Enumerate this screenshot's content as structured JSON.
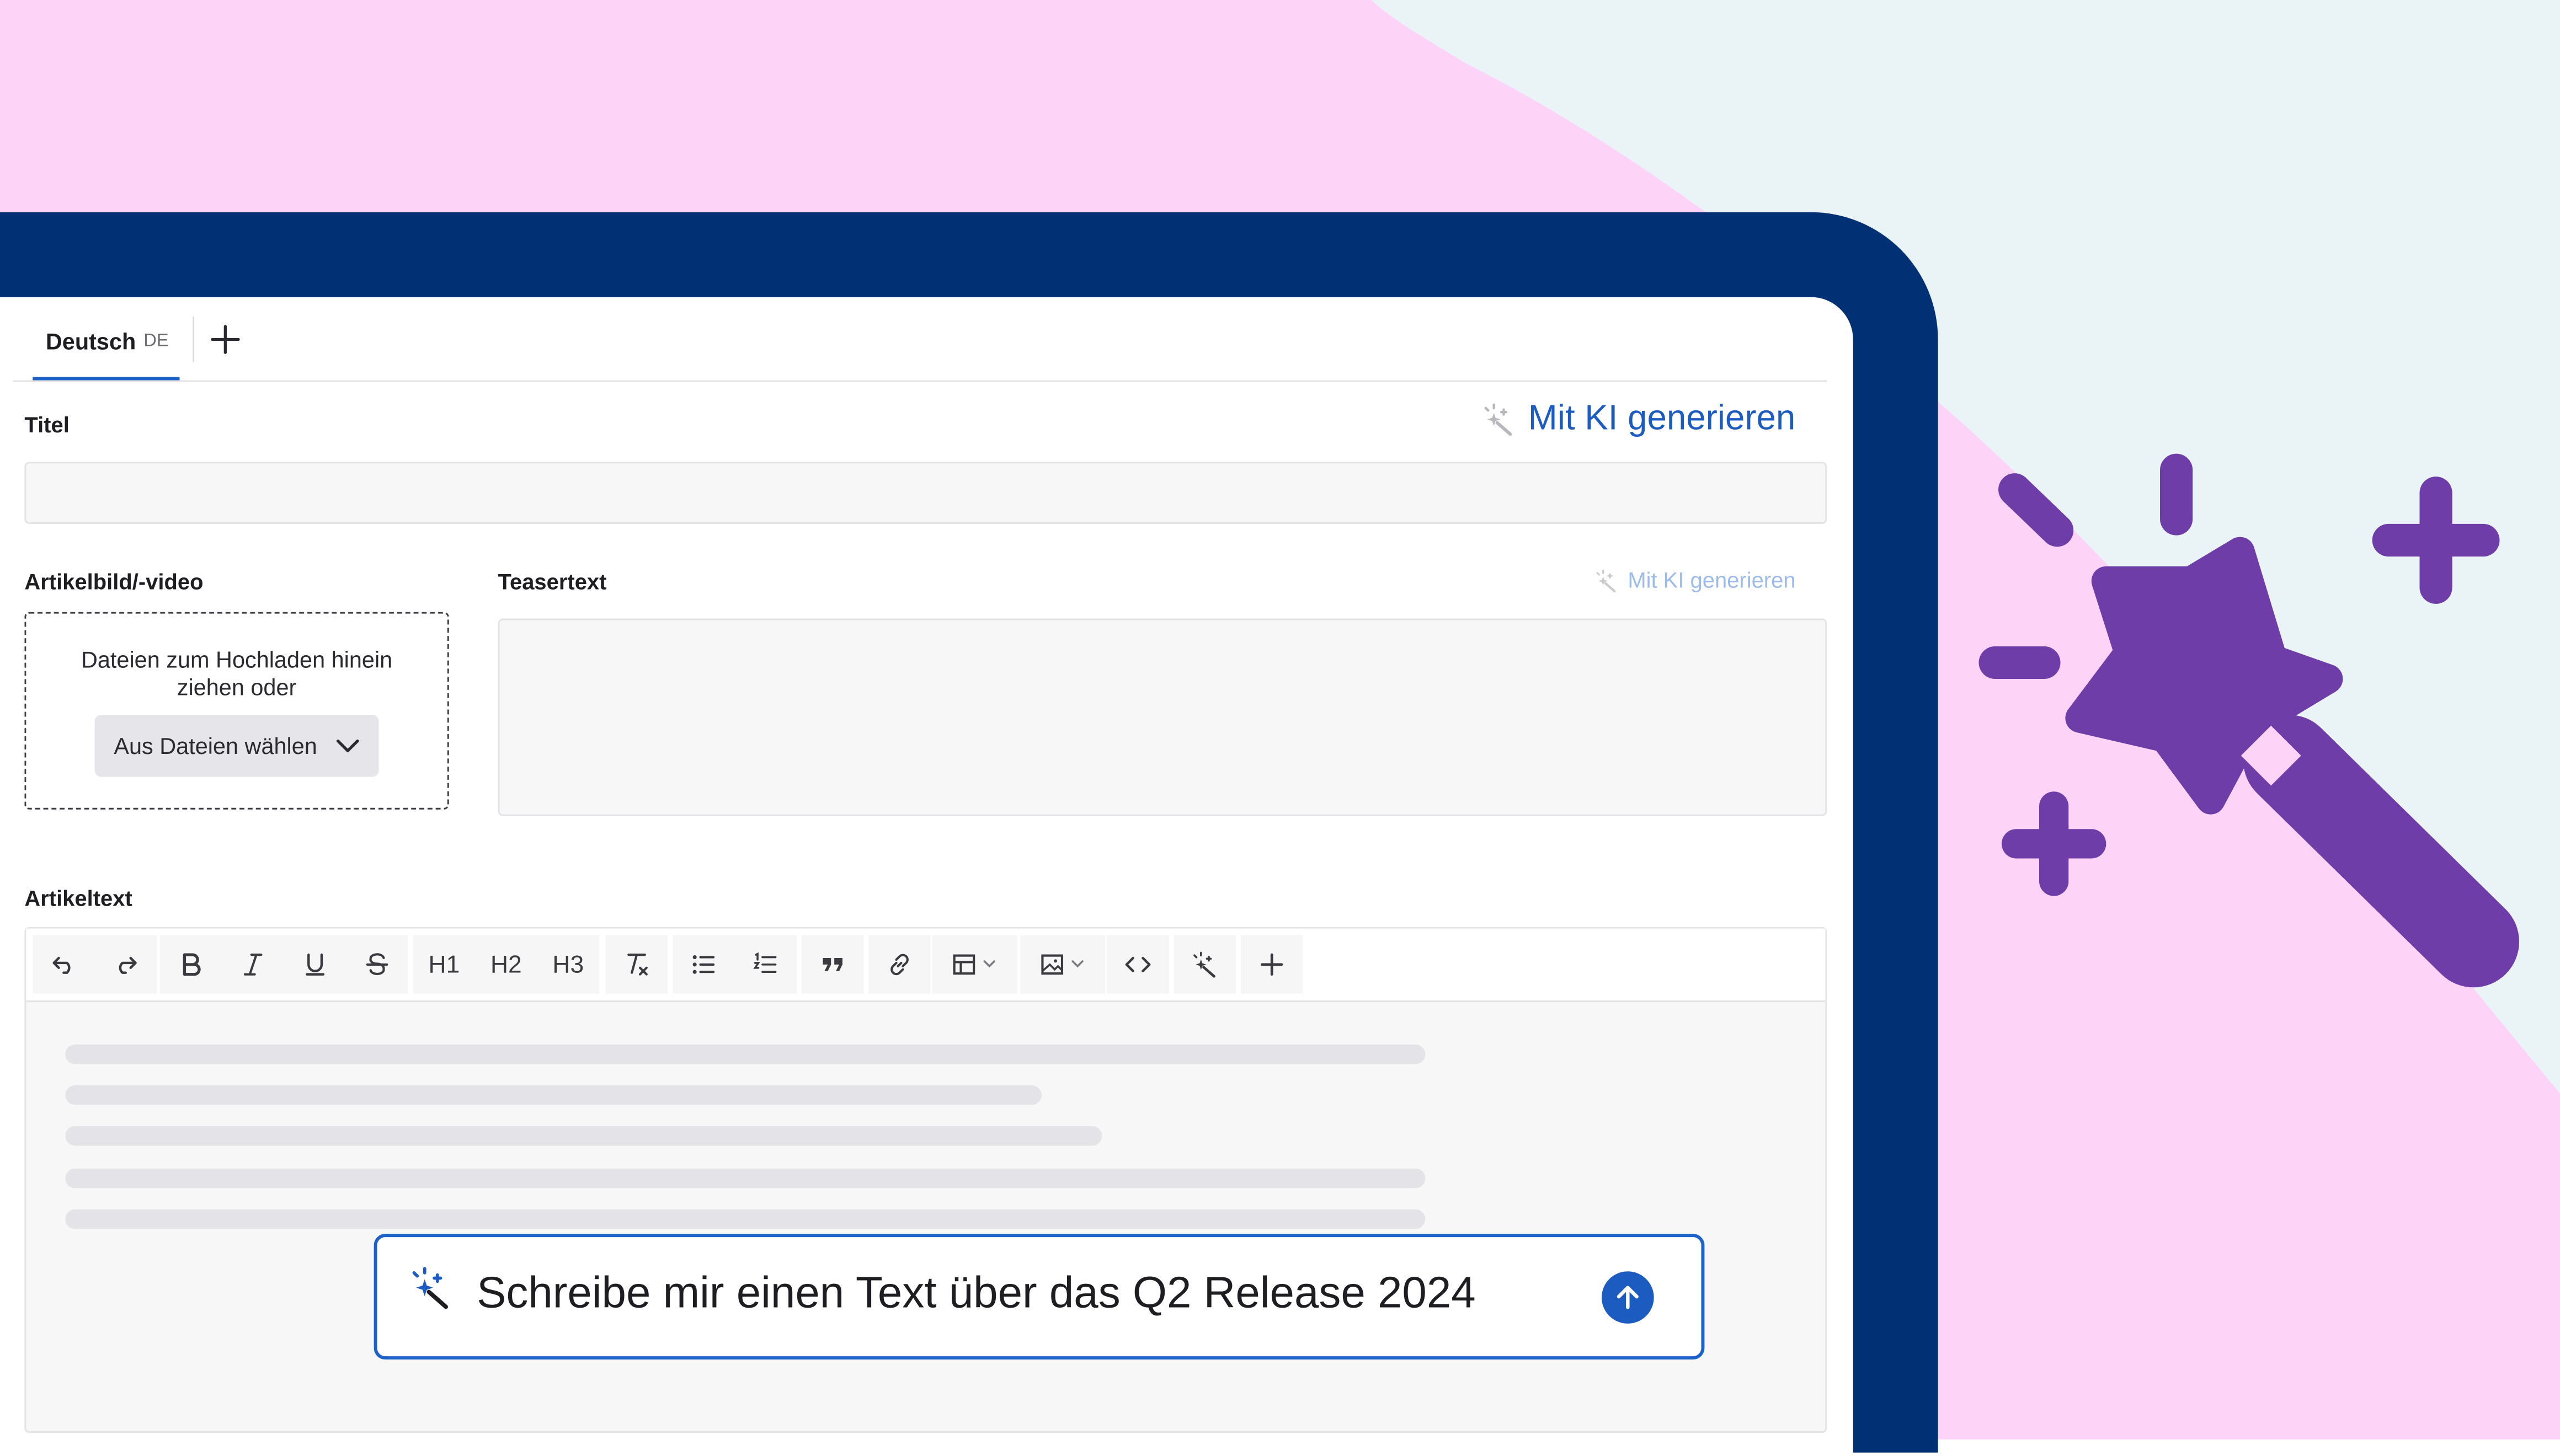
{
  "colors": {
    "pink": "#fdd3f8",
    "mint": "#eaf4f6",
    "navy": "#023074",
    "purple": "#6e3da8",
    "accent_blue": "#1c5bc0"
  },
  "tabs": {
    "active_label": "Deutsch",
    "active_code": "DE",
    "add_icon": "plus-icon"
  },
  "fields": {
    "title_label": "Titel",
    "media_label": "Artikelbild/-video",
    "teaser_label": "Teasertext",
    "body_label": "Artikeltext"
  },
  "ai": {
    "generate_label": "Mit KI generieren",
    "generate_small_label": "Mit KI generieren",
    "icon": "magic-wand-icon"
  },
  "upload": {
    "hint": "Dateien zum Hochladen hinein ziehen oder",
    "button_label": "Aus Dateien wählen"
  },
  "toolbar": {
    "heading1": "H1",
    "heading2": "H2",
    "heading3": "H3",
    "icons": [
      "undo-icon",
      "redo-icon",
      "bold-icon",
      "italic-icon",
      "underline-icon",
      "strikethrough-icon",
      "clear-format-icon",
      "bullet-list-icon",
      "numbered-list-icon",
      "quote-icon",
      "link-icon",
      "table-icon",
      "image-icon",
      "code-icon",
      "magic-wand-icon",
      "plus-icon"
    ]
  },
  "prompt": {
    "text": "Schreibe mir einen Text über das Q2 Release 2024",
    "send_icon": "arrow-up-icon"
  }
}
